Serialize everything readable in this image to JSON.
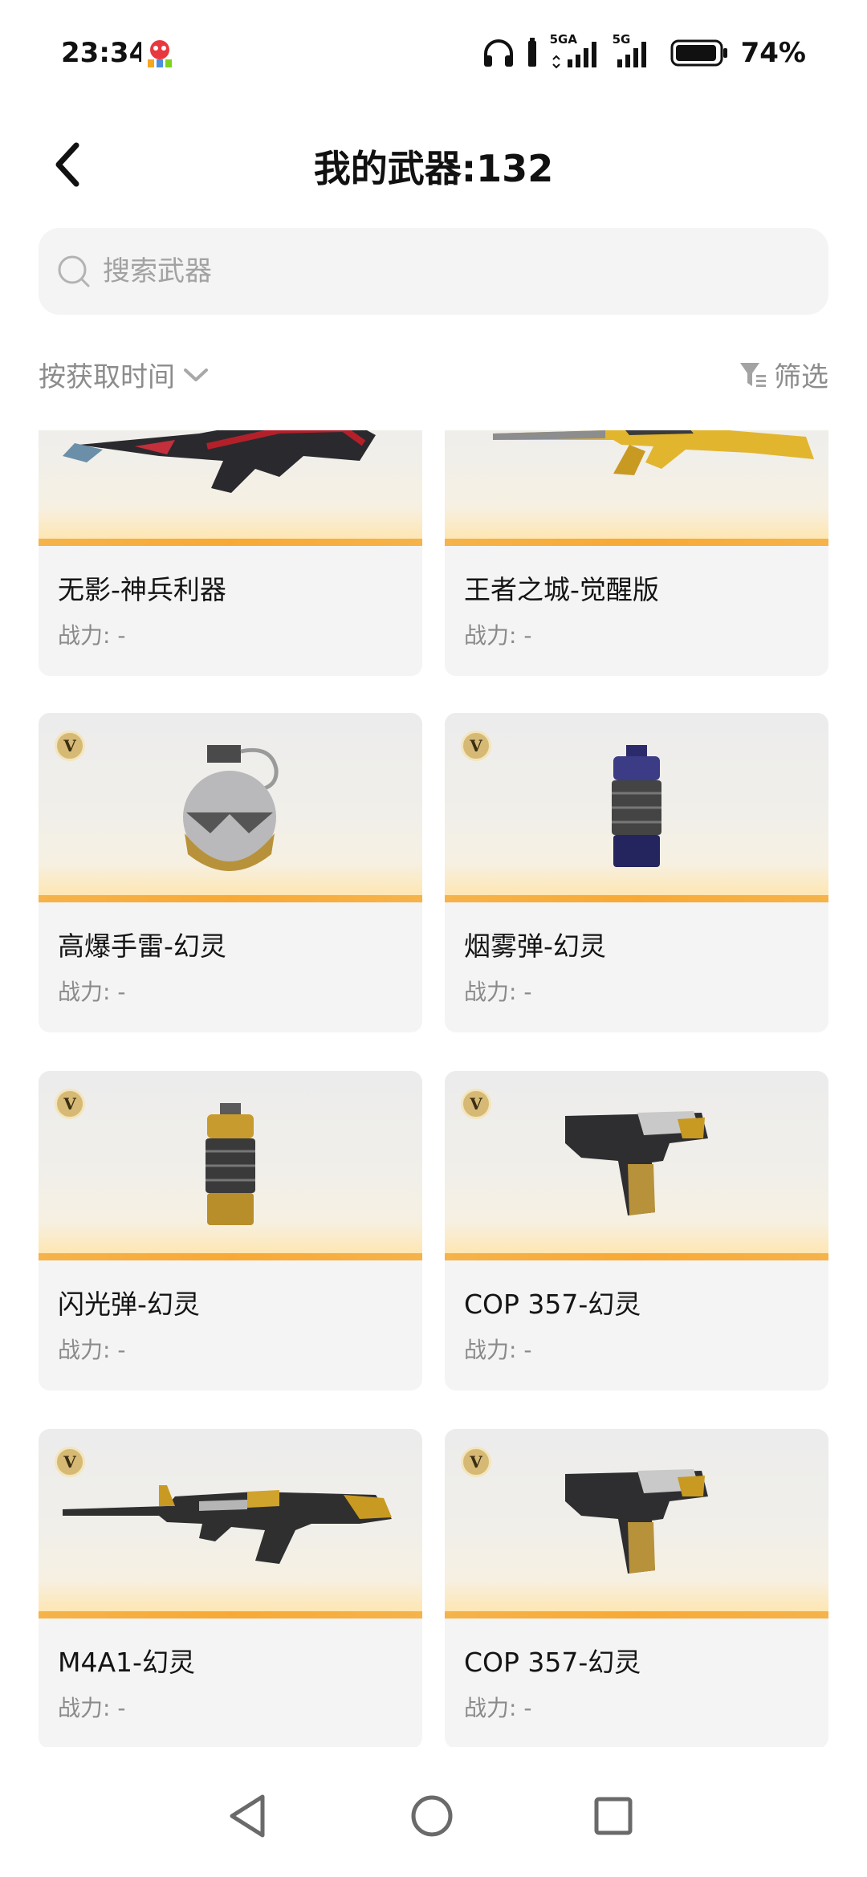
{
  "status_bar": {
    "time": "23:34",
    "network_1": "5GA",
    "network_2": "5G",
    "battery": "74%"
  },
  "header": {
    "title": "我的武器:132"
  },
  "search": {
    "placeholder": "搜索武器"
  },
  "toolbar": {
    "sort_label": "按获取时间",
    "filter_label": "筛选"
  },
  "weapons": [
    {
      "name": "无影-神兵利器",
      "power": "战力: -",
      "badge": ""
    },
    {
      "name": "王者之城-觉醒版",
      "power": "战力: -",
      "badge": ""
    },
    {
      "name": "高爆手雷-幻灵",
      "power": "战力: -",
      "badge": "V"
    },
    {
      "name": "烟雾弹-幻灵",
      "power": "战力: -",
      "badge": "V"
    },
    {
      "name": "闪光弹-幻灵",
      "power": "战力: -",
      "badge": "V"
    },
    {
      "name": "COP 357-幻灵",
      "power": "战力: -",
      "badge": "V"
    },
    {
      "name": "M4A1-幻灵",
      "power": "战力: -",
      "badge": "V"
    },
    {
      "name": "COP 357-幻灵",
      "power": "战力: -",
      "badge": "V"
    }
  ],
  "icons": {
    "back": "chevron-left-icon",
    "search": "search-icon",
    "sort": "chevron-down-icon",
    "filter": "filter-icon",
    "nav_back": "triangle-back-icon",
    "nav_home": "circle-home-icon",
    "nav_recents": "square-recents-icon"
  },
  "colors": {
    "accent_bar": "#f5b34a",
    "card_bg": "#f4f4f4",
    "muted_text": "#8c8c8c"
  }
}
